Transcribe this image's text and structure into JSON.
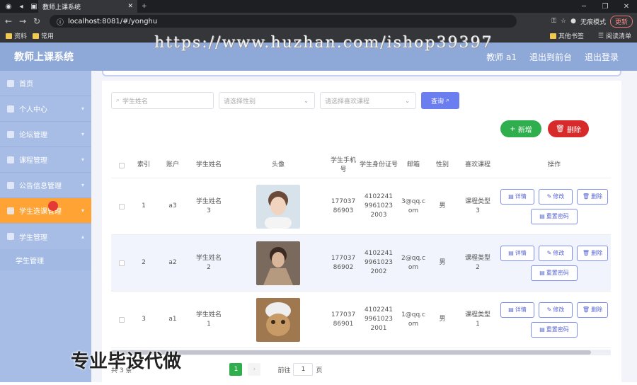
{
  "browser": {
    "tab_title": "教师上课系统",
    "url_host": "localhost",
    "url_rest": ":8081/#/yonghu",
    "incognito_label": "无痕模式",
    "update_label": "更新",
    "bookmarks": [
      "资料",
      "常用"
    ],
    "bookmarks_right": [
      "其他书签",
      "阅读清单"
    ]
  },
  "header": {
    "title": "教师上课系统",
    "user": "教师 a1",
    "to_front": "退出到前台",
    "logout": "退出登录"
  },
  "sidebar": {
    "items": [
      {
        "label": "首页"
      },
      {
        "label": "个人中心"
      },
      {
        "label": "论坛管理"
      },
      {
        "label": "课程管理"
      },
      {
        "label": "公告信息管理"
      },
      {
        "label": "学生选课管理"
      },
      {
        "label": "学生管理"
      }
    ],
    "sub_items": [
      {
        "label": "学生管理"
      }
    ]
  },
  "search": {
    "name_placeholder": "学生姓名",
    "gender_placeholder": "请选择性别",
    "course_placeholder": "请选择喜欢课程",
    "query_label": "查询"
  },
  "actions": {
    "add": "新增",
    "delete": "删除"
  },
  "table": {
    "headers": [
      "索引",
      "账户",
      "学生姓名",
      "头像",
      "学生手机号",
      "学生身份证号",
      "邮箱",
      "性别",
      "喜欢课程",
      "操作"
    ],
    "rows": [
      {
        "index": "1",
        "account": "a3",
        "name": "学生姓名3",
        "phone": "17703786903",
        "idcard": "410224199610232003",
        "email": "3@qq.com",
        "gender": "男",
        "course": "课程类型3"
      },
      {
        "index": "2",
        "account": "a2",
        "name": "学生姓名2",
        "phone": "17703786902",
        "idcard": "410224199610232002",
        "email": "2@qq.com",
        "gender": "男",
        "course": "课程类型2"
      },
      {
        "index": "3",
        "account": "a1",
        "name": "学生姓名1",
        "phone": "17703786901",
        "idcard": "410224199610232001",
        "email": "1@qq.com",
        "gender": "男",
        "course": "课程类型1"
      }
    ],
    "op_detail": "详情",
    "op_edit": "修改",
    "op_delete": "删除",
    "op_reset": "重置密码"
  },
  "pager": {
    "total": "共 3 条",
    "current_page": "1",
    "goto_prefix": "前往",
    "goto_value": "1",
    "goto_suffix": "页"
  },
  "watermark": {
    "url": "https://www.huzhan.com/ishop39397",
    "cn": "专业毕设代做"
  }
}
